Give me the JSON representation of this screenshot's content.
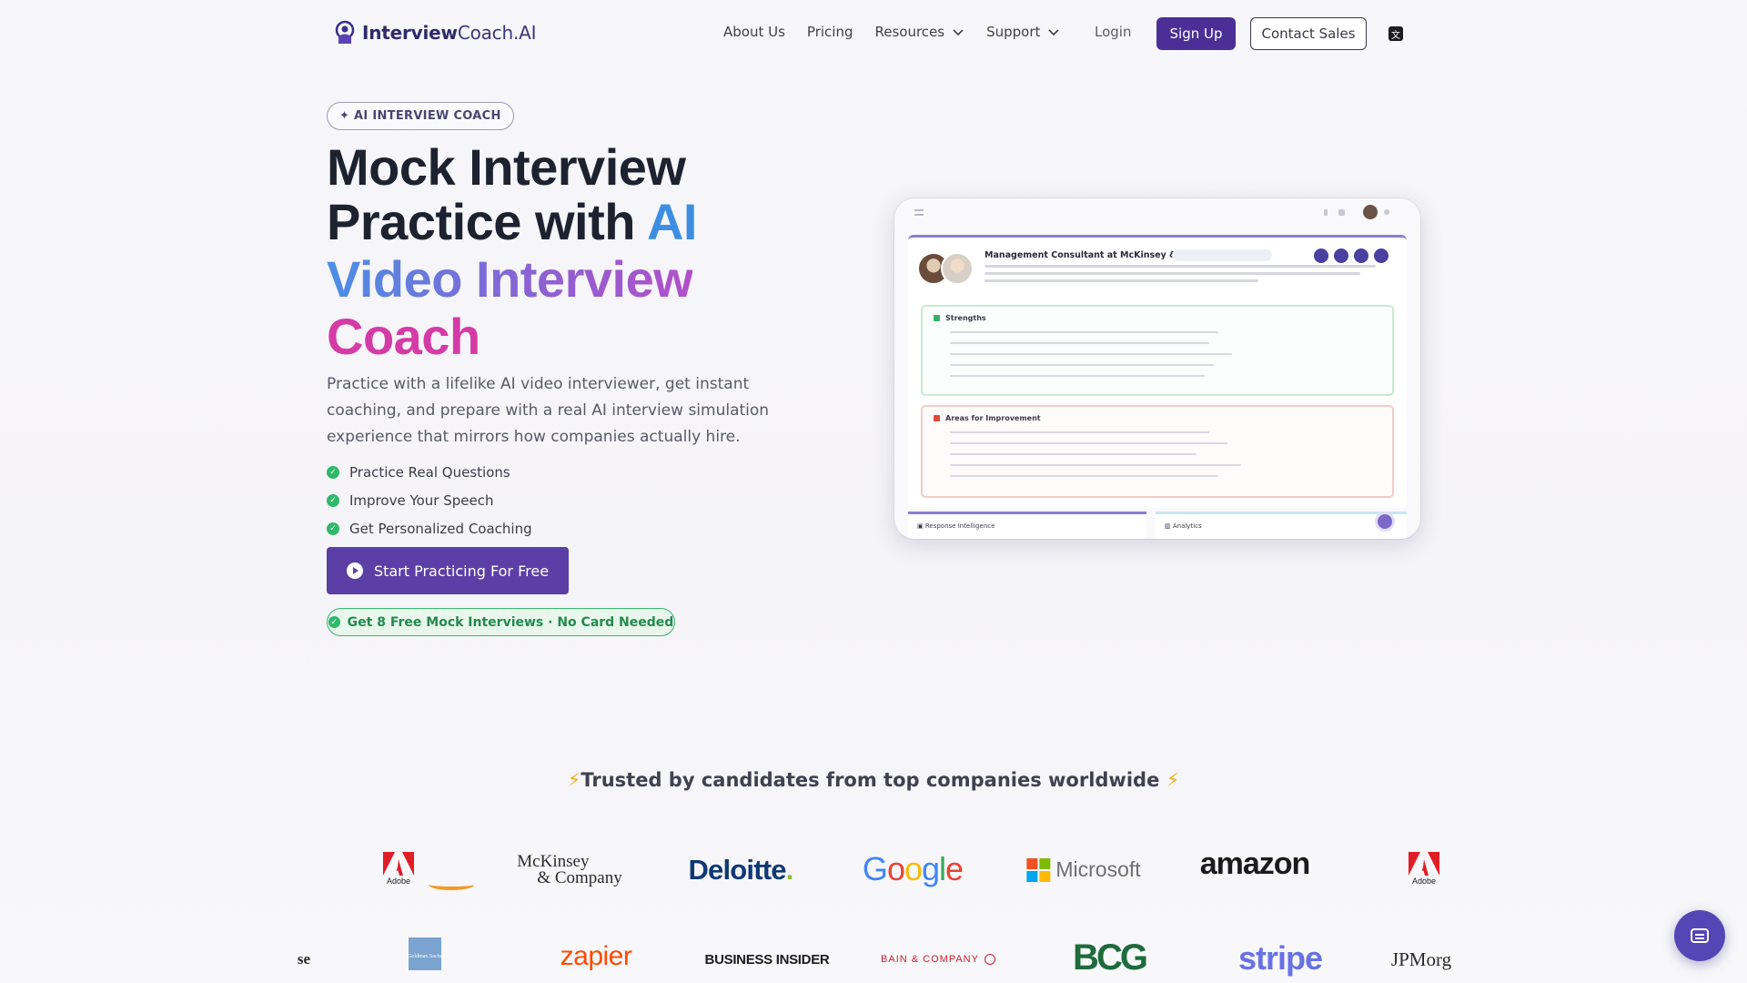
{
  "header": {
    "logo": {
      "bold": "Interview",
      "rest": "Coach.AI"
    },
    "nav": [
      {
        "label": "About Us",
        "dropdown": false
      },
      {
        "label": "Pricing",
        "dropdown": false
      },
      {
        "label": "Resources",
        "dropdown": true
      },
      {
        "label": "Support",
        "dropdown": true
      }
    ],
    "login": "Login",
    "signup": "Sign Up",
    "contact": "Contact Sales",
    "lang_icon": "translate-icon"
  },
  "hero": {
    "badge": "✦ AI INTERVIEW COACH",
    "title": {
      "line1": "Mock Interview",
      "line2_a": "Practice with ",
      "line2_b": "AI",
      "line3": "Video Interview",
      "line4": "Coach"
    },
    "subtitle": "Practice with a lifelike AI video interviewer, get instant coaching, and prepare with a real AI interview simulation experience that mirrors how companies actually hire.",
    "features": [
      "Practice Real Questions",
      "Improve Your Speech",
      "Get Personalized Coaching"
    ],
    "cta": "Start Practicing For Free",
    "free_note": "Get 8 Free Mock Interviews · No Card Needed"
  },
  "mockup": {
    "title": "Management Consultant at McKinsey & Company",
    "strengths": "Strengths",
    "improvement": "Areas for Improvement",
    "tab1": "Response Intelligence",
    "tab2": "Analytics"
  },
  "trusted": {
    "text": "Trusted by candidates from top companies worldwide",
    "bolt": "⚡"
  },
  "logos": {
    "row1": [
      "Adobe",
      "McKinsey & Company",
      "Deloitte",
      "Google",
      "Microsoft",
      "amazon",
      "Adobe"
    ],
    "row2": [
      "se",
      "Goldman Sachs",
      "zapier",
      "BUSINESS INSIDER",
      "BAIN & COMPANY",
      "BCG",
      "stripe",
      "JPMorg"
    ],
    "mck": {
      "a": "McKinsey",
      "b": "& Company"
    },
    "deloitte": "Deloitte",
    "microsoft": "Microsoft",
    "amazon": "amazon",
    "adobe": "Adobe",
    "se": "se",
    "gs": "Goldman Sachs",
    "zapier": "zapier",
    "bi": "BUSINESS INSIDER",
    "bain": "BAIN & COMPANY",
    "bcg": "BCG",
    "stripe": "stripe",
    "jpm": "JPMorg"
  },
  "colors": {
    "brand": "#4c2f96",
    "cta": "#5b3fa6",
    "success": "#2fb86a",
    "ai_blue": "#3d8ee3",
    "coach_pink": "#d53ba6"
  },
  "chat_icon": "chat-bubble-icon"
}
